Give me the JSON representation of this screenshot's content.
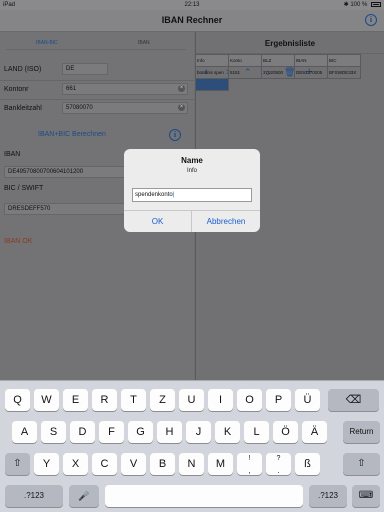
{
  "status_bar": {
    "carrier": "iPad",
    "time": "22:13",
    "battery": "100 %"
  },
  "nav": {
    "title": "IBAN Rechner"
  },
  "left": {
    "tabs": [
      "IBAN-BIC",
      "IBAN"
    ],
    "country_label": "LAND (ISO)",
    "country_value": "DE",
    "account_label": "Kontonr",
    "account_value": "661",
    "bank_label": "Bankleitzahl",
    "bank_value": "57080070",
    "compute_link": "IBAN+BIC Berechnen",
    "iban_label": "IBAN",
    "iban_value": "DE49570800700604101200",
    "bic_label": "BIC / SWIFT",
    "bic_value": "DRESDEFF570",
    "result_text": "IBAN OK"
  },
  "right": {
    "title": "Ergebnisliste",
    "table": {
      "headers": [
        "Info",
        "Konto",
        "BLZ",
        "IBAN",
        "BIC"
      ],
      "rows": [
        [
          "bündnis spen",
          "5151",
          "37020500",
          "DE93370205",
          "BFSWDE33X"
        ]
      ]
    }
  },
  "dialog": {
    "title": "Name",
    "message": "Info",
    "input_value": "spendenkonto",
    "ok": "OK",
    "cancel": "Abbrechen"
  },
  "keyboard": {
    "row1": [
      "Q",
      "W",
      "E",
      "R",
      "T",
      "Z",
      "U",
      "I",
      "O",
      "P",
      "Ü"
    ],
    "row2": [
      "A",
      "S",
      "D",
      "F",
      "G",
      "H",
      "J",
      "K",
      "L",
      "Ö",
      "Ä"
    ],
    "row3": [
      "Y",
      "X",
      "C",
      "V",
      "B",
      "N",
      "M",
      "!",
      "?",
      "ß"
    ],
    "row3_sub": [
      ",",
      "."
    ],
    "return": "Return",
    "numbers": ".?123"
  }
}
